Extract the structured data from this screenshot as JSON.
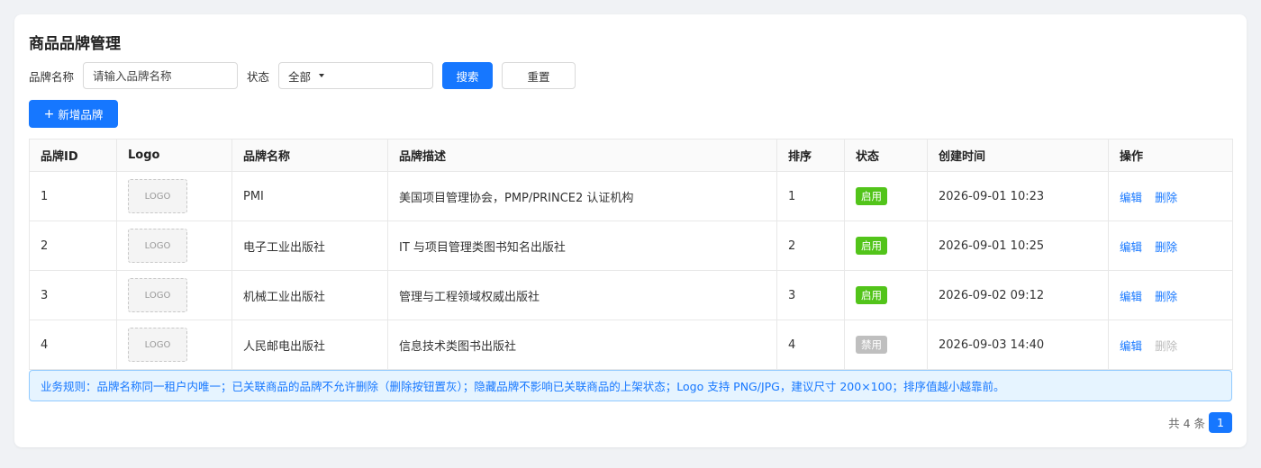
{
  "page": {
    "title": "商品品牌管理"
  },
  "filters": {
    "brand_name_label": "品牌名称",
    "brand_name_placeholder": "请输入品牌名称",
    "brand_name_value": "",
    "status_label": "状态",
    "status_value": "全部",
    "search_label": "搜索",
    "reset_label": "重置"
  },
  "toolbar": {
    "add_plus": "+",
    "add_label": "新增品牌"
  },
  "table": {
    "columns": [
      "品牌ID",
      "Logo",
      "品牌名称",
      "品牌描述",
      "排序",
      "状态",
      "创建时间",
      "操作"
    ],
    "rows": [
      {
        "id": "1",
        "logo": "LOGO",
        "name": "PMI",
        "desc": "美国项目管理协会，PMP/PRINCE2 认证机构",
        "sort": "1",
        "status": "启用",
        "status_color": "#52c41a",
        "created": "2026-09-01 10:23",
        "edit": "编辑",
        "delete": "删除",
        "delete_disabled": false
      },
      {
        "id": "2",
        "logo": "LOGO",
        "name": "电子工业出版社",
        "desc": "IT 与项目管理类图书知名出版社",
        "sort": "2",
        "status": "启用",
        "status_color": "#52c41a",
        "created": "2026-09-01 10:25",
        "edit": "编辑",
        "delete": "删除",
        "delete_disabled": false
      },
      {
        "id": "3",
        "logo": "LOGO",
        "name": "机械工业出版社",
        "desc": "管理与工程领域权威出版社",
        "sort": "3",
        "status": "启用",
        "status_color": "#52c41a",
        "created": "2026-09-02 09:12",
        "edit": "编辑",
        "delete": "删除",
        "delete_disabled": false
      },
      {
        "id": "4",
        "logo": "LOGO",
        "name": "人民邮电出版社",
        "desc": "信息技术类图书出版社",
        "sort": "4",
        "status": "禁用",
        "status_color": "#bfbfbf",
        "created": "2026-09-03 14:40",
        "edit": "编辑",
        "delete": "删除",
        "delete_disabled": true
      }
    ]
  },
  "rule_note": "业务规则：品牌名称同一租户内唯一；已关联商品的品牌不允许删除（删除按钮置灰）；隐藏品牌不影响已关联商品的上架状态；Logo 支持 PNG/JPG，建议尺寸 200×100；排序值越小越靠前。",
  "pagination": {
    "total_text": "共 4 条",
    "current_page": "1"
  },
  "colors": {
    "primary": "#1677ff",
    "enabled_tag": "#52c41a",
    "disabled_tag": "#bfbfbf",
    "info_bg": "#e6f4ff",
    "info_border": "#91caff"
  }
}
